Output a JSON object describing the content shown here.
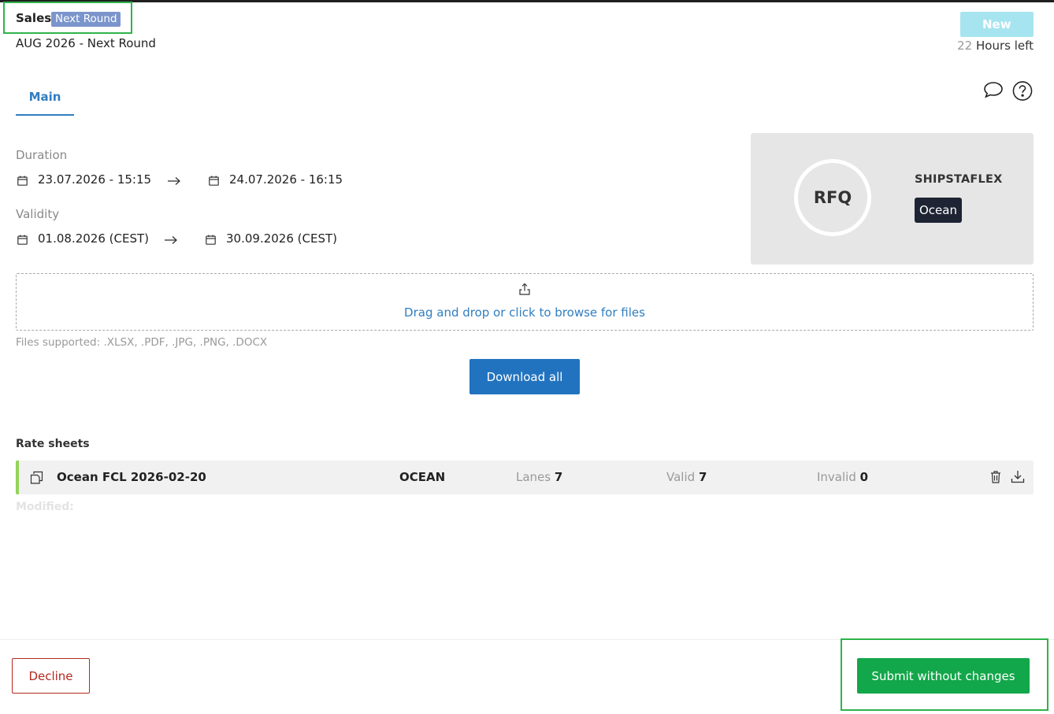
{
  "header": {
    "title": "Sales",
    "round_badge": "Next Round",
    "subtitle": "AUG 2026 - Next Round",
    "status_badge": "New",
    "hours_left_number": "22",
    "hours_left_text": "Hours left"
  },
  "tabs": [
    {
      "label": "Main",
      "active": true
    }
  ],
  "toolbar_icons": [
    "chat-bubble-icon",
    "help-icon"
  ],
  "duration": {
    "label": "Duration",
    "start": "23.07.2026 - 15:15",
    "end": "24.07.2026 - 16:15"
  },
  "validity": {
    "label": "Validity",
    "start": "01.08.2026 (CEST)",
    "end": "30.09.2026 (CEST)"
  },
  "summary_card": {
    "type_label": "RFQ",
    "company": "SHIPSTAFLEX",
    "mode_tag": "Ocean"
  },
  "upload": {
    "drop_text": "Drag and drop or click to browse for files",
    "files_supported": "Files supported: .XLSX, .PDF, .JPG, .PNG, .DOCX",
    "download_all": "Download all"
  },
  "rate_sheets": {
    "title": "Rate sheets",
    "rows": [
      {
        "name": "Ocean FCL  2026-02-20",
        "mode": "OCEAN",
        "lanes_label": "Lanes",
        "lanes": "7",
        "valid_label": "Valid",
        "valid": "7",
        "invalid_label": "Invalid",
        "invalid": "0"
      }
    ],
    "modified_label": "Modified:"
  },
  "footer": {
    "decline": "Decline",
    "submit": "Submit without changes"
  },
  "colors": {
    "accent_blue": "#2f7ec1",
    "primary_button": "#2273bf",
    "submit_green": "#12a74a",
    "decline_red": "#b22a1f",
    "highlight_green": "#2fb34a",
    "status_new": "#a6e4f0",
    "round_badge": "#7b95cc",
    "row_marker": "#93d35b"
  }
}
